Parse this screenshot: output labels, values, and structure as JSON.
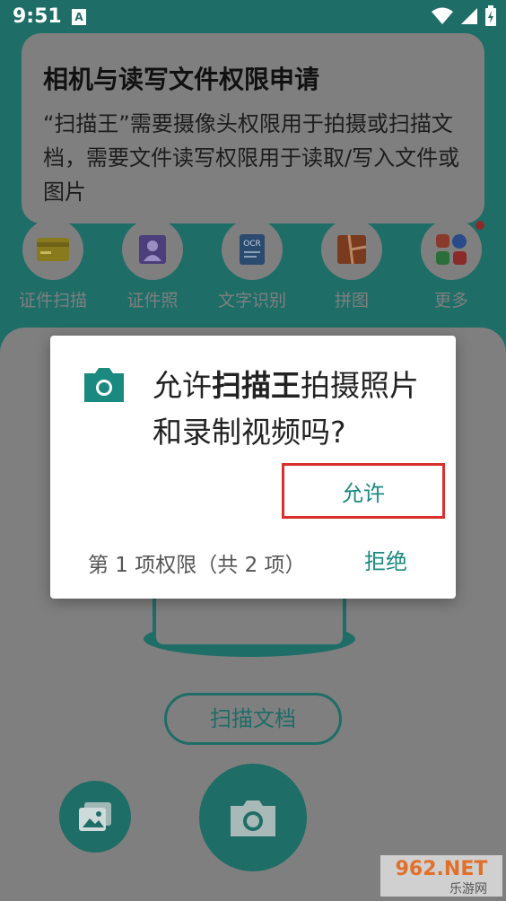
{
  "status_bar": {
    "time": "9:51",
    "notif": "A"
  },
  "permission_card": {
    "title": "相机与读写文件权限申请",
    "description": "“扫描王”需要摄像头权限用于拍摄或扫描文档，需要文件读写权限用于读取/写入文件或图片"
  },
  "tools": [
    {
      "label": "证件扫描",
      "icon": "id-card-icon"
    },
    {
      "label": "证件照",
      "icon": "id-photo-icon"
    },
    {
      "label": "文字识别",
      "icon": "ocr-icon"
    },
    {
      "label": "拼图",
      "icon": "collage-icon"
    },
    {
      "label": "更多",
      "icon": "more-apps-icon"
    }
  ],
  "scan_button": {
    "label": "扫描文档"
  },
  "dialog": {
    "message_prefix": "允许",
    "app_name": "扫描王",
    "message_suffix": "拍摄照片和录制视频吗?",
    "allow_label": "允许",
    "perm_count": "第 1 项权限（共 2 项）",
    "deny_label": "拒绝"
  },
  "watermark": {
    "top": "962.NET",
    "bottom": "乐游网"
  },
  "colors": {
    "teal": "#1f6d67",
    "accent": "#1a8a80",
    "highlight": "#d9302c"
  }
}
